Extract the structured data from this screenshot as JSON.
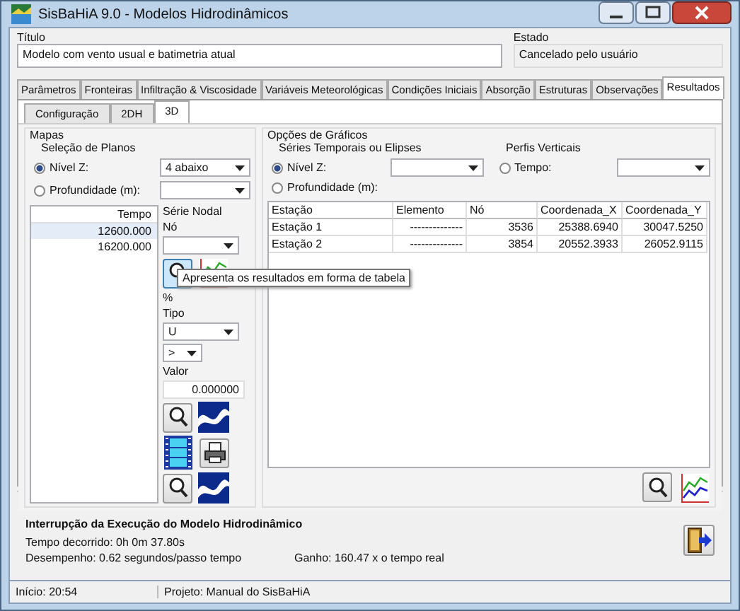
{
  "window": {
    "title": "SisBaHiA 9.0 - Modelos Hidrodinâmicos"
  },
  "header": {
    "title_label": "Título",
    "title_value": "Modelo com vento usual e batimetria atual",
    "state_label": "Estado",
    "state_value": "Cancelado pelo usuário"
  },
  "tabs": [
    {
      "label": "Parâmetros",
      "selected": false
    },
    {
      "label": "Fronteiras",
      "selected": false
    },
    {
      "label": "Infiltração & Viscosidade",
      "selected": false
    },
    {
      "label": "Variáveis Meteorológicas",
      "selected": false
    },
    {
      "label": "Condições Iniciais",
      "selected": false
    },
    {
      "label": "Absorção",
      "selected": false
    },
    {
      "label": "Estruturas",
      "selected": false
    },
    {
      "label": "Observações",
      "selected": false
    },
    {
      "label": "Resultados",
      "selected": true
    }
  ],
  "subtabs": [
    {
      "label": "Configuração",
      "selected": false
    },
    {
      "label": "2DH",
      "selected": false
    },
    {
      "label": "3D",
      "selected": true
    }
  ],
  "maps": {
    "label": "Mapas",
    "planes_label": "Seleção de Planos",
    "planes": [
      {
        "label": "Nível Z:",
        "selected": true,
        "value": "4 abaixo"
      },
      {
        "label": "Profundidade (m):",
        "selected": false
      }
    ],
    "time_list": {
      "column": "Tempo",
      "rows": [
        {
          "value": "12600.000",
          "selected": true
        },
        {
          "value": "16200.000",
          "selected": false
        }
      ]
    },
    "nodal": {
      "label": "Série Nodal",
      "node_label": "Nó",
      "percent_label": "%",
      "type_label": "Tipo",
      "type_value": "U",
      "operator_value": ">",
      "value_label": "Valor",
      "value": "0.000000"
    }
  },
  "graphs": {
    "label": "Opções de Gráficos",
    "series_label": "Séries Temporais ou Elipses",
    "series": [
      {
        "label": "Nível Z:",
        "selected": true
      },
      {
        "label": "Profundidade (m):",
        "selected": false
      }
    ],
    "profiles_label": "Perfis Verticais",
    "profiles": [
      {
        "label": "Tempo:",
        "selected": false
      }
    ],
    "table": {
      "columns": [
        "Estação",
        "Elemento",
        "Nó",
        "Coordenada_X",
        "Coordenada_Y"
      ],
      "rows": [
        [
          "Estação 1",
          "--------------",
          "3536",
          "25388.6940",
          "30047.5250"
        ],
        [
          "Estação 2",
          "--------------",
          "3854",
          "20552.3933",
          "26052.9115"
        ]
      ]
    }
  },
  "tooltip": "Apresenta os resultados em forma de tabela",
  "interruption": {
    "title": "Interrupção da Execução do Modelo Hidrodinâmico",
    "elapsed": "Tempo decorrido:  0h  0m 37.80s",
    "performance": "Desempenho: 0.62 segundos/passo tempo",
    "gain": "Ganho: 160.47 x o tempo real"
  },
  "status_bar": [
    "Início: 20:54",
    "Projeto: Manual do SisBaHiA"
  ]
}
